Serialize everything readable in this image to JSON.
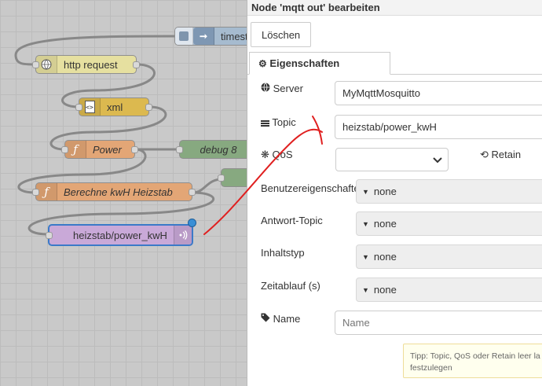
{
  "canvas": {
    "nodes": {
      "timestamp": "timest",
      "http_request": "http request",
      "xml": "xml",
      "power": "Power",
      "debug": "debug 8",
      "berechne": "Berechne kwH Heizstab",
      "mqtt_out": "heizstab/power_kwH"
    }
  },
  "tray": {
    "title": "Node 'mqtt out' bearbeiten",
    "delete_label": "Löschen",
    "tab_label": "Eigenschaften",
    "server": {
      "label": "Server",
      "value": "MyMqttMosquitto"
    },
    "topic": {
      "label": "Topic",
      "value": "heizstab/power_kwH"
    },
    "qos": {
      "label": "QoS",
      "value": ""
    },
    "retain_label": "Retain",
    "user_props": {
      "label": "Benutzereigenschafte",
      "value": "none"
    },
    "response_topic": {
      "label": "Antwort-Topic",
      "value": "none"
    },
    "content_type": {
      "label": "Inhaltstyp",
      "value": "none"
    },
    "timeout": {
      "label": "Zeitablauf (s)",
      "value": "none"
    },
    "name": {
      "label": "Name",
      "placeholder": "Name",
      "value": ""
    },
    "tip_line1": "Tipp: Topic, QoS oder Retain leer la",
    "tip_line2": "festzulegen"
  },
  "colors": {
    "http_node": "#e6e0a0",
    "xml_node": "#dcb94f",
    "function_node": "#e3a676",
    "debug_node": "#87a980",
    "mqtt_node": "#c9a9d8",
    "annotation_arrow": "#e02020"
  }
}
